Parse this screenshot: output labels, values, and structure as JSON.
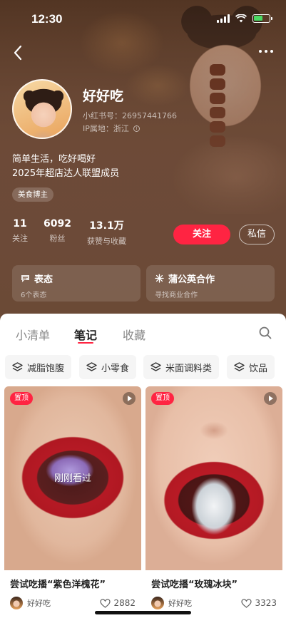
{
  "status": {
    "time": "12:30"
  },
  "profile": {
    "name": "好好吃",
    "uid": "小红书号：26957441766",
    "ip": "IP属地：浙江",
    "bio_line1": "简单生活，吃好喝好",
    "bio_line2": "2025年超店达人联盟成员",
    "tag": "美食博主"
  },
  "stats": [
    {
      "num": "11",
      "label": "关注"
    },
    {
      "num": "6092",
      "label": "粉丝"
    },
    {
      "num": "13.1万",
      "label": "获赞与收藏"
    }
  ],
  "actions": {
    "follow": "关注",
    "message": "私信"
  },
  "cards": [
    {
      "title": "表态",
      "sub": "6个表态",
      "icon": "chat-bubble-icon"
    },
    {
      "title": "蒲公英合作",
      "sub": "寻找商业合作",
      "icon": "dandelion-icon"
    }
  ],
  "tabs": [
    "小清单",
    "笔记",
    "收藏"
  ],
  "active_tab": "笔记",
  "chips": [
    "减脂饱腹",
    "小零食",
    "米面调料类",
    "饮品"
  ],
  "notes": [
    {
      "badge": "置顶",
      "overlay": "刚刚看过",
      "title": "尝试吃播“紫色洋槐花”",
      "author": "好好吃",
      "likes": "2882"
    },
    {
      "badge": "置顶",
      "overlay": "",
      "title": "尝试吃播“玫瑰冰块”",
      "author": "好好吃",
      "likes": "3323"
    }
  ],
  "colors": {
    "accent": "#ff2442",
    "hero_bg": "#6b4a36"
  }
}
